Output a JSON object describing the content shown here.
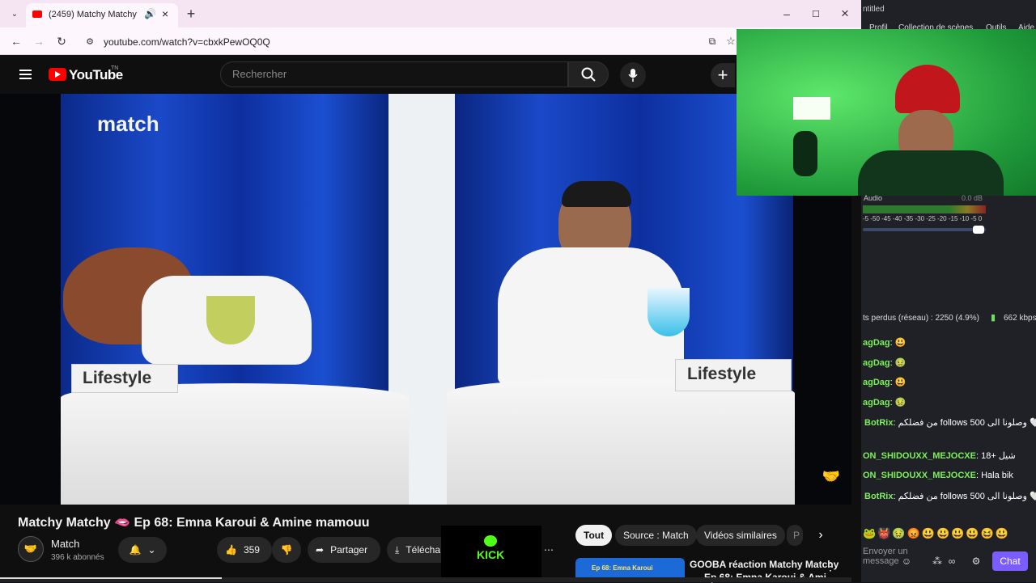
{
  "browser": {
    "tab_title": "(2459) Matchy Matchy",
    "url": "youtube.com/watch?v=cbxkPewOQ0Q"
  },
  "youtube": {
    "logo": "YouTube",
    "logo_tm": "TN",
    "search_placeholder": "Rechercher",
    "video_overlay_brand": "match",
    "table_label_left": "Lifestyle",
    "table_label_right": "Lifestyle",
    "video_title": "Matchy Matchy 🫦 Ep 68: Emna Karoui & Amine mamouu",
    "channel_name": "Match",
    "subscribers": "396 k abonnés",
    "likes": "359",
    "share_label": "Partager",
    "download_label": "Télécha",
    "kick_label": "KICK",
    "chips": [
      "Tout",
      "Source : Match",
      "Vidéos similaires",
      "P"
    ],
    "rec_title_line1": "GOOBA réaction Matchy Matchy",
    "rec_title_line2": "Ep 68: Emna Karoui & Ami",
    "rec_thumb_text": "Ep 68: Emna Karoui"
  },
  "obs": {
    "title_fragment": "ntitled",
    "menu_items": [
      "Profil",
      "Collection de scènes",
      "Outils",
      "Aide"
    ],
    "audio_label": "Audio",
    "audio_db": "0.0 dB",
    "meter_scale": "-5 -50 -45 -40 -35 -30 -25 -20 -15 -10 -5 0",
    "stats": "ts perdus (réseau) : 2250 (4.9%)",
    "bitrate": "662 kbps",
    "chat_input_placeholder": "Envoyer un message",
    "chat_button": "Chat"
  },
  "chat": [
    {
      "name": "agDag",
      "msg": ""
    },
    {
      "name": "agDag",
      "msg": ""
    },
    {
      "name": "agDag",
      "msg": ""
    },
    {
      "name": "agDag",
      "msg": ""
    },
    {
      "name": "BotRix",
      "msg": "من فضلكم follows وصلونا الى 500 🤍"
    },
    {
      "name": "ON_SHIDOUXX_MEJOCXE",
      "msg": "18+ شيل"
    },
    {
      "name": "ON_SHIDOUXX_MEJOCXE",
      "msg": "Hala bik"
    },
    {
      "name": "BotRix",
      "msg": "من فضلكم follows وصلونا الى 500 🤍"
    }
  ],
  "colors": {
    "yt_red": "#ff0000",
    "chat_button": "#7b5cff",
    "cam_green": "#2fb34a",
    "kick_green": "#53fc18"
  }
}
